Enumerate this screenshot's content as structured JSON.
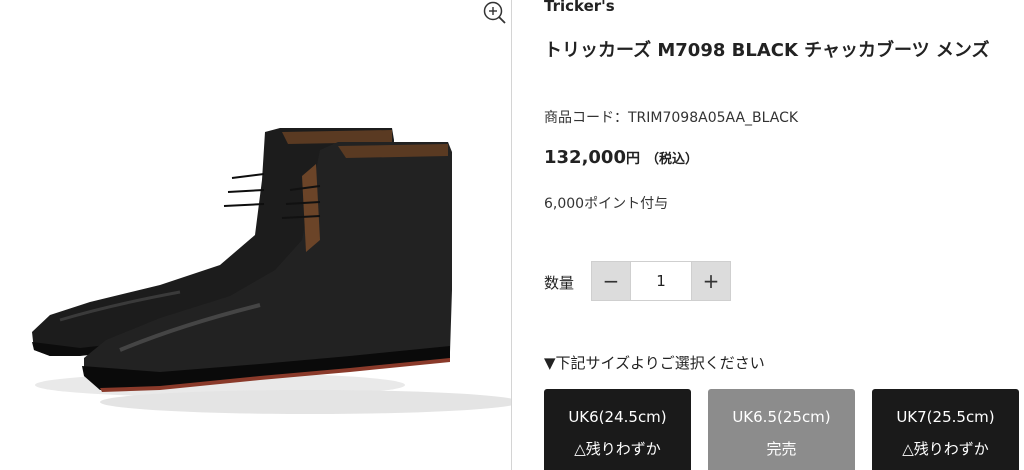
{
  "product": {
    "brand": "Tricker's",
    "title": "トリッカーズ M7098 BLACK チャッカブーツ メンズ",
    "code": "商品コード：TRIM7098A05AA_BLACK",
    "price_amount": "132,000",
    "price_currency": "円",
    "price_tax": "（税込）",
    "points": "6,000ポイント付与"
  },
  "quantity": {
    "label": "数量",
    "decrement": "−",
    "value": "1",
    "increment": "+"
  },
  "sizes": {
    "heading": "▼下記サイズよりご選択ください",
    "options": [
      {
        "label": "UK6(24.5cm)",
        "status": "△残りわずか",
        "color": "#1a1a1a"
      },
      {
        "label": "UK6.5(25cm)",
        "status": "完売",
        "color": "#8c8c8c"
      },
      {
        "label": "UK7(25.5cm)",
        "status": "△残りわずか",
        "color": "#1a1a1a"
      }
    ]
  },
  "icons": {
    "zoom": "zoom-in-icon",
    "image": "boots-product-image"
  }
}
